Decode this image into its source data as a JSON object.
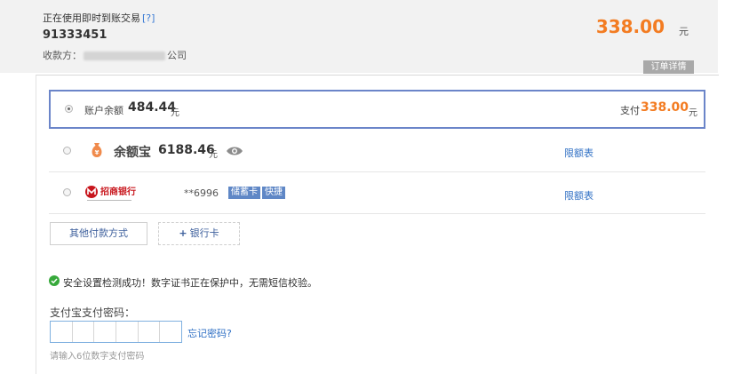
{
  "header": {
    "mode_text": "正在使用即时到账交易",
    "help_label": "[?]",
    "order_no": "91333451",
    "payee_label": "收款方：",
    "payee_suffix": "公司",
    "amount": "338.00",
    "currency": "元",
    "detail_tab": "订单详情"
  },
  "methods": [
    {
      "name": "账户余额",
      "amount": "484.44",
      "unit": "元",
      "pay_label": "支付",
      "pay_amount": "338.00",
      "pay_unit": "元",
      "selected": true
    },
    {
      "name": "余额宝",
      "amount": "6188.46",
      "unit": "元",
      "icon": "money-bag-icon",
      "limit_link": "限额表",
      "selected": false
    },
    {
      "name": "招商银行",
      "card_no": "**6996",
      "tags": [
        "储蓄卡",
        "快捷"
      ],
      "icon": "cmb-bank-logo",
      "limit_link": "限额表",
      "selected": false
    }
  ],
  "buttons": {
    "other_methods": "其他付款方式",
    "bank_card_plus": "+",
    "bank_card": "银行卡"
  },
  "security": {
    "message": "安全设置检测成功！数字证书正在保护中，无需短信校验。"
  },
  "password": {
    "label": "支付宝支付密码：",
    "cells": 6,
    "forgot_link": "忘记密码?",
    "hint": "请输入6位数字支付密码"
  },
  "colors": {
    "accent_orange": "#f37c22",
    "link_blue": "#2f6fc4",
    "selected_border": "#6b85c9",
    "tag_blue": "#5f87c6"
  }
}
